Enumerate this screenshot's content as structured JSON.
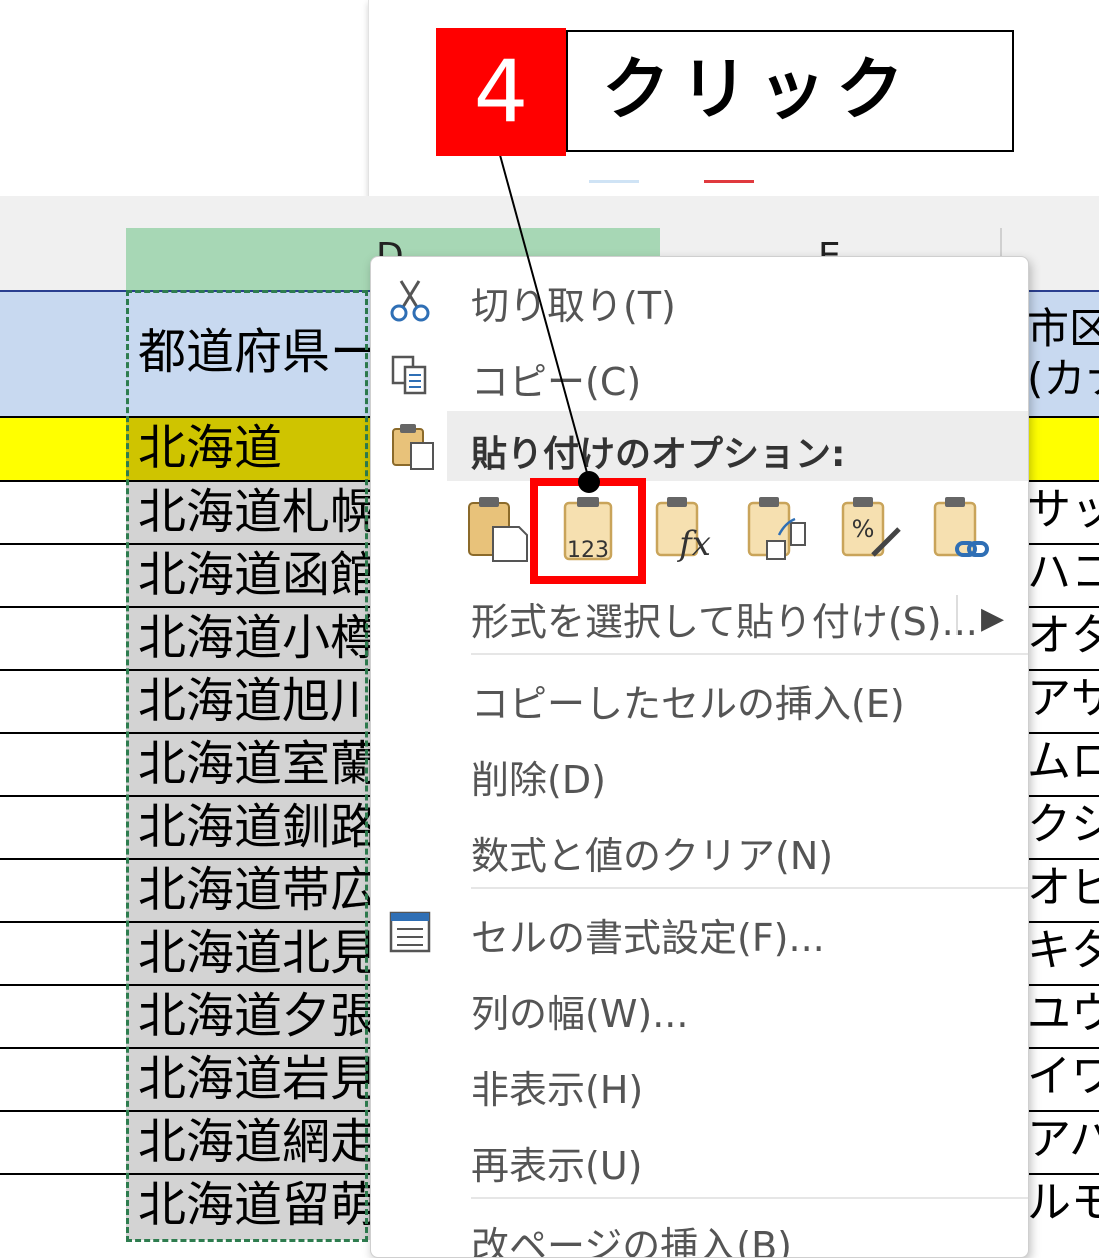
{
  "columns": {
    "d_letter": "D",
    "e_letter": "E"
  },
  "header_row": {
    "d_text": "都道府県ー",
    "f_text_line1": "市区",
    "f_text_line2": "(カナ"
  },
  "prefecture_row": {
    "d_text": "北海道"
  },
  "data_rows": [
    {
      "d": "北海道札幌",
      "f": "サッポ"
    },
    {
      "d": "北海道函館",
      "f": "ハコダ"
    },
    {
      "d": "北海道小樽",
      "f": "オタル"
    },
    {
      "d": "北海道旭川",
      "f": "アサヒ"
    },
    {
      "d": "北海道室蘭",
      "f": "ムロラ"
    },
    {
      "d": "北海道釧路",
      "f": "クシロ"
    },
    {
      "d": "北海道帯広",
      "f": "オビヒ"
    },
    {
      "d": "北海道北見",
      "f": "キタミ"
    },
    {
      "d": "北海道夕張",
      "f": "ユウバ"
    },
    {
      "d": "北海道岩見",
      "f": "イワミ"
    },
    {
      "d": "北海道網走",
      "f": "アバシ"
    },
    {
      "d": "北海道留萌",
      "f": "ルモイ"
    }
  ],
  "context_menu": {
    "cut": "切り取り(T)",
    "copy": "コピー(C)",
    "paste_options_header": "貼り付けのオプション:",
    "paste_values_label": "123",
    "paste_special": "形式を選択して貼り付け(S)...",
    "insert_copied": "コピーしたセルの挿入(E)",
    "delete": "削除(D)",
    "clear_contents": "数式と値のクリア(N)",
    "format_cells": "セルの書式設定(F)...",
    "column_width": "列の幅(W)...",
    "hide": "非表示(H)",
    "unhide": "再表示(U)",
    "insert_page_break": "改ページの挿入(B)"
  },
  "callout": {
    "step_number": "4",
    "label": "クリック"
  },
  "colors": {
    "highlight": "#ff0000",
    "selection_green": "#2e7d4f",
    "header_blue": "#c8d9f0",
    "yellow": "#ffff00"
  }
}
